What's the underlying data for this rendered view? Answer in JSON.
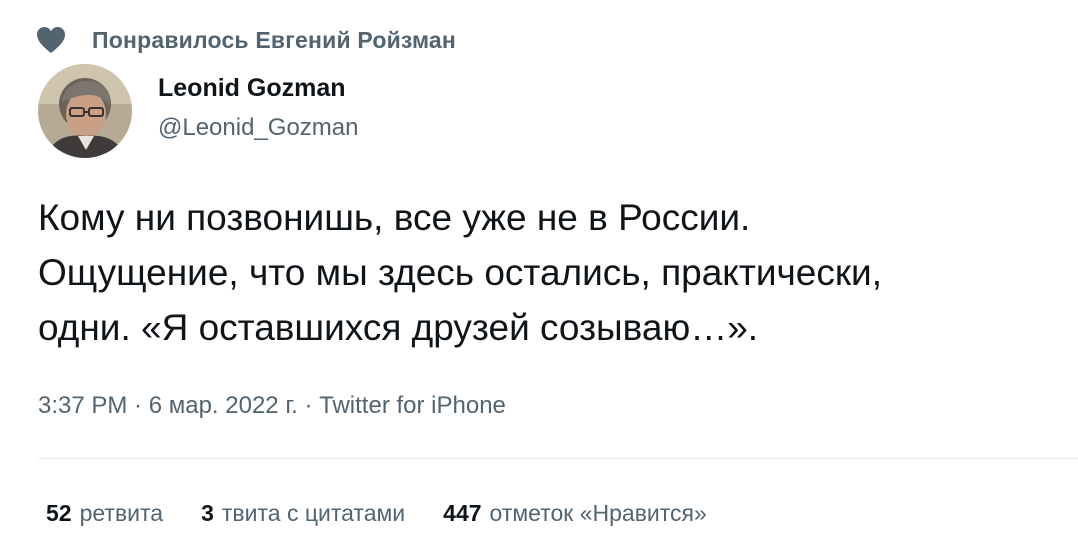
{
  "social_context": {
    "icon": "heart-icon",
    "text": "Понравилось Евгений Ройзман"
  },
  "author": {
    "name": "Leonid Gozman",
    "handle": "@Leonid_Gozman"
  },
  "tweet": {
    "lines": [
      "Кому ни позвонишь, все уже не в России.",
      "Ощущение, что мы здесь остались, практически,",
      "одни. «Я оставшихся друзей созываю…»."
    ]
  },
  "meta": {
    "text": "3:37 PM · 6 мар. 2022 г. · Twitter for iPhone"
  },
  "stats": [
    {
      "count": "52",
      "label": "ретвита"
    },
    {
      "count": "3",
      "label": "твита с цитатами"
    },
    {
      "count": "447",
      "label": "отметок «Нравится»"
    }
  ],
  "colors": {
    "primary_text": "#0f1419",
    "secondary_text": "#536471",
    "divider": "#e6eaed"
  }
}
